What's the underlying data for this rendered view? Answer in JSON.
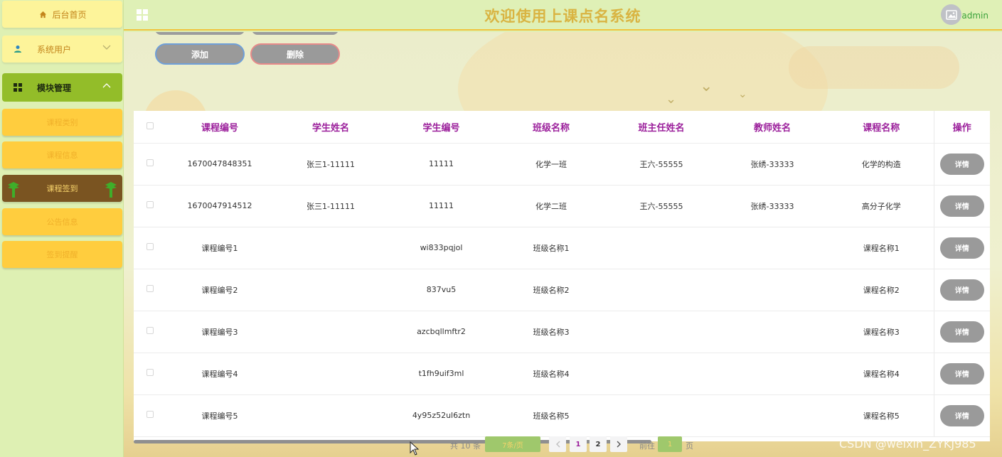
{
  "header": {
    "title": "欢迎使用上课点名系统",
    "user": "admin",
    "accent": "#d9b442"
  },
  "sidebar": {
    "home": "后台首页",
    "system_users": "系统用户",
    "module_mgmt": "模块管理",
    "sub_items": [
      "课程类别",
      "课程信息",
      "课程签到",
      "公告信息",
      "签到提醒"
    ],
    "active_sub": "课程签到"
  },
  "toolbar": {
    "add_label": "添加",
    "delete_label": "删除"
  },
  "table": {
    "columns": [
      "课程编号",
      "学生姓名",
      "学生编号",
      "班级名称",
      "班主任姓名",
      "教师姓名",
      "课程名称",
      "操作"
    ],
    "detail_label": "详情",
    "rows": [
      [
        "1670047848351",
        "张三1-11111",
        "11111",
        "化学一班",
        "王六-55555",
        "张绣-33333",
        "化学的构造"
      ],
      [
        "1670047914512",
        "张三1-11111",
        "11111",
        "化学二班",
        "王六-55555",
        "张绣-33333",
        "高分子化学"
      ],
      [
        "课程编号1",
        "",
        "wi833pqjol",
        "班级名称1",
        "",
        "",
        "课程名称1"
      ],
      [
        "课程编号2",
        "",
        "837vu5",
        "班级名称2",
        "",
        "",
        "课程名称2"
      ],
      [
        "课程编号3",
        "",
        "azcbqllmftr2",
        "班级名称3",
        "",
        "",
        "课程名称3"
      ],
      [
        "课程编号4",
        "",
        "t1fh9uif3ml",
        "班级名称4",
        "",
        "",
        "课程名称4"
      ],
      [
        "课程编号5",
        "",
        "4y95z52ul6ztn",
        "班级名称5",
        "",
        "",
        "课程名称5"
      ]
    ]
  },
  "pagination": {
    "total": "共 10 条",
    "page_size": "7条/页",
    "pages": [
      "1",
      "2"
    ],
    "current": "1",
    "goto_label": "前往",
    "goto_value": "1",
    "page_suffix": "页"
  },
  "watermark": "CSDN @weixin_ZYKJ985"
}
